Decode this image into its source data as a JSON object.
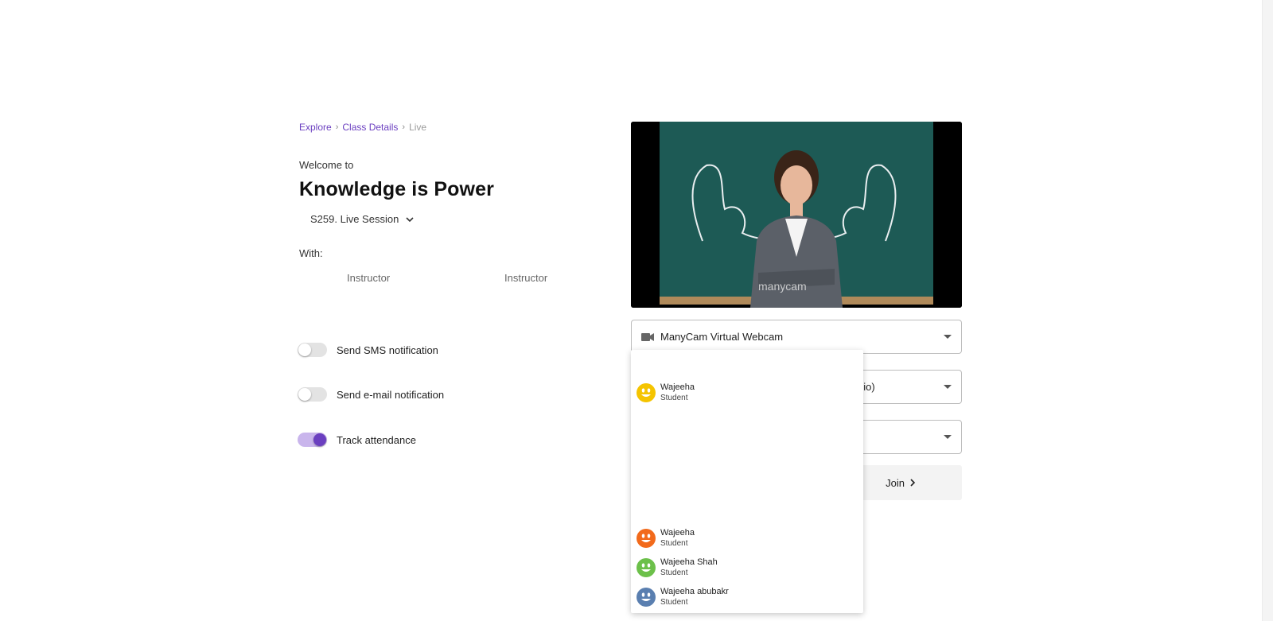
{
  "breadcrumb": {
    "items": [
      "Explore",
      "Class Details"
    ],
    "current": "Live"
  },
  "header": {
    "welcome": "Welcome to",
    "title": "Knowledge is Power",
    "session": "S259. Live Session"
  },
  "instructors": {
    "label": "With:",
    "items": [
      "Instructor",
      "Instructor"
    ]
  },
  "toggles": [
    {
      "label": "Send SMS notification",
      "on": false
    },
    {
      "label": "Send e-mail notification",
      "on": false
    },
    {
      "label": "Track attendance",
      "on": true
    }
  ],
  "devices": {
    "camera": "ManyCam Virtual Webcam",
    "microphone_visible": "dio)"
  },
  "video": {
    "watermark": "manycam"
  },
  "join_label": "Join",
  "dropdown": {
    "users": [
      {
        "name": "Wajeeha",
        "role": "Student",
        "color": "#f5c400"
      },
      {
        "name": "Wajeeha",
        "role": "Student",
        "color": "#f26a1b"
      },
      {
        "name": "Wajeeha Shah",
        "role": "Student",
        "color": "#6cc04a"
      },
      {
        "name": "Wajeeha abubakr",
        "role": "Student",
        "color": "#5a7fb0"
      }
    ]
  },
  "colors": {
    "accent": "#6b3fc0",
    "accent_light": "#c9b5ec",
    "chalkboard": "#1d5a55"
  }
}
